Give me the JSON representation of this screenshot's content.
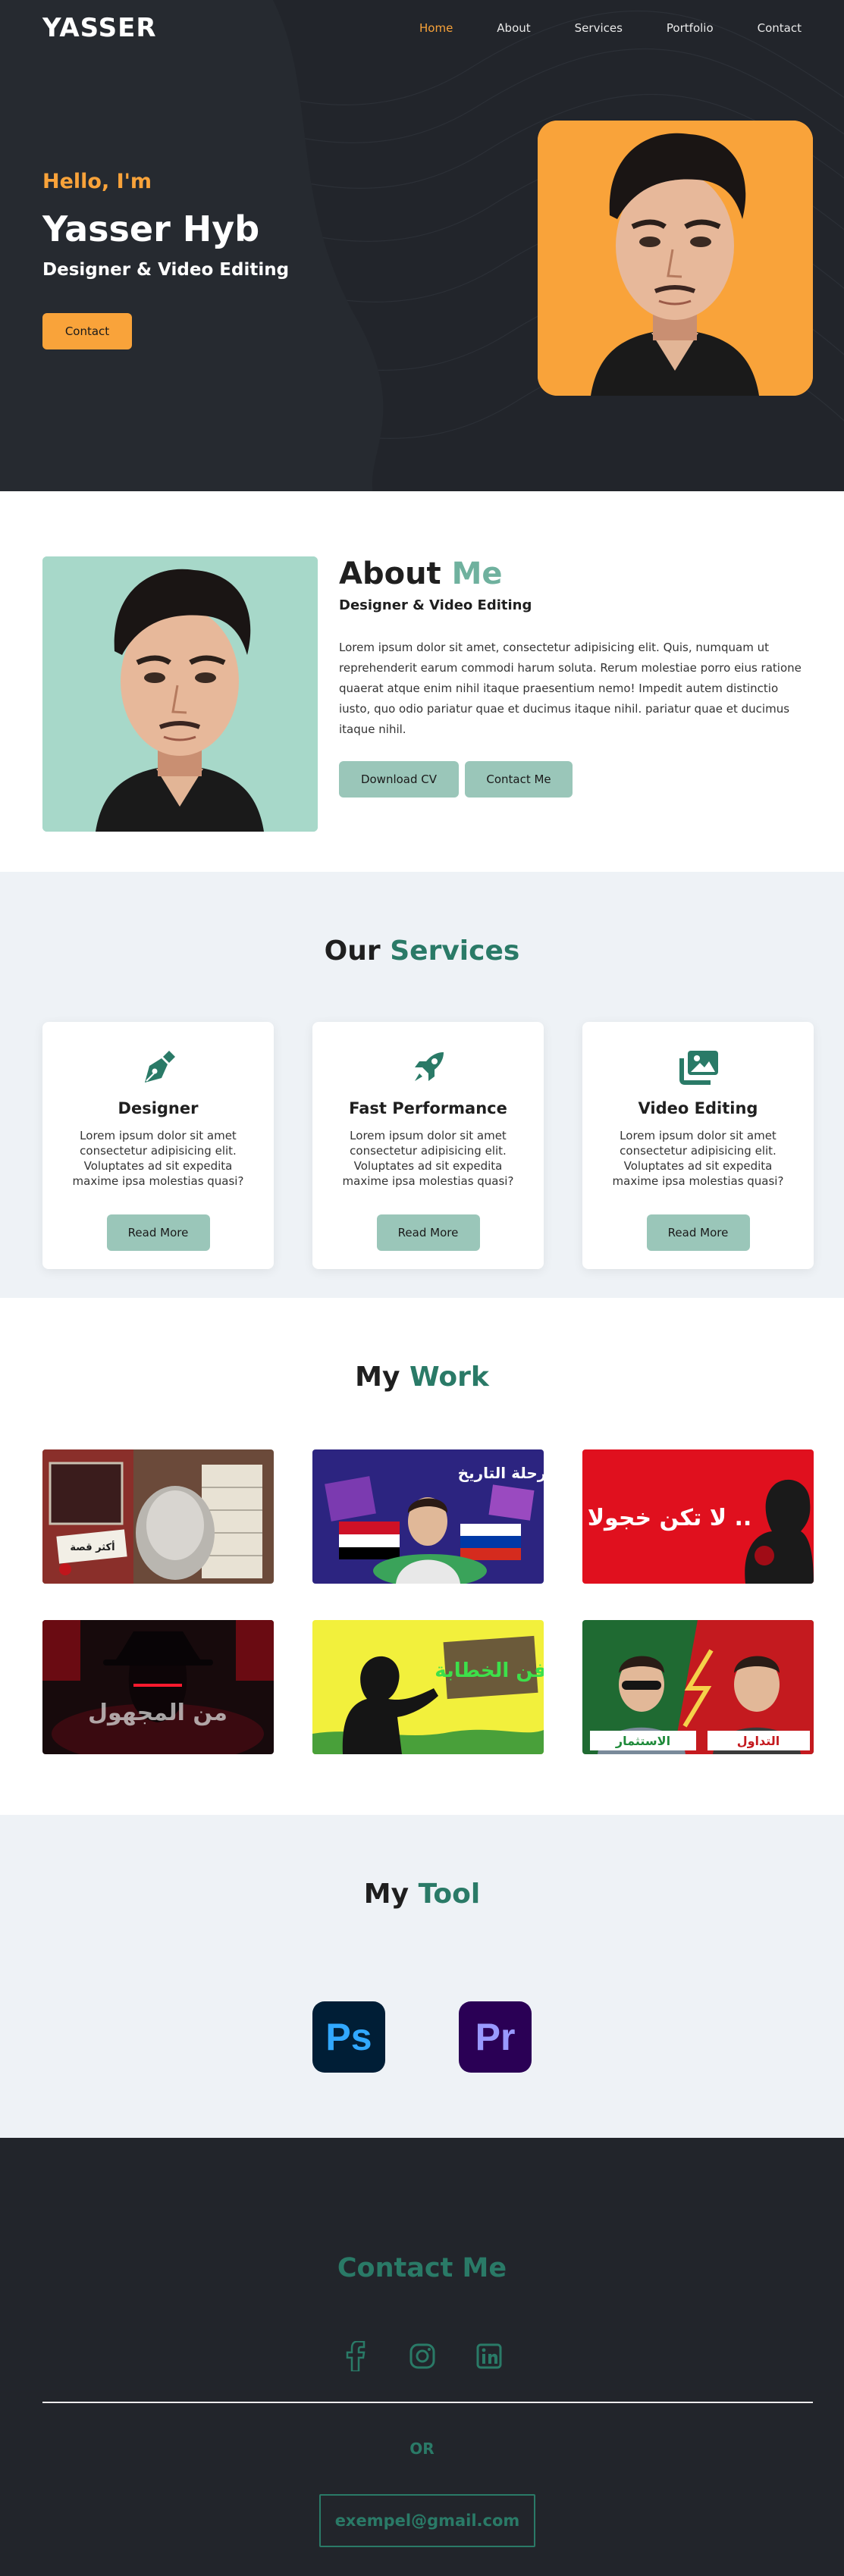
{
  "header": {
    "logo": "YASSER",
    "nav": [
      "Home",
      "About",
      "Services",
      "Portfolio",
      "Contact"
    ],
    "active": "Home"
  },
  "hero": {
    "greeting": "Hello, I'm",
    "name": "Yasser Hyb",
    "role": "Designer & Video Editing",
    "button": "Contact"
  },
  "about": {
    "title_a": "About",
    "title_b": "Me",
    "subtitle": "Designer & Video Editing",
    "paragraph": "Lorem ipsum dolor sit amet, consectetur adipisicing elit. Quis, numquam ut reprehenderit earum commodi harum soluta. Rerum molestiae porro eius ratione quaerat atque enim nihil itaque praesentium nemo! Impedit autem distinctio iusto, quo odio pariatur quae et ducimus itaque nihil. pariatur quae et ducimus itaque nihil.",
    "download_button": "Download CV",
    "contact_button": "Contact Me"
  },
  "services": {
    "title_a": "Our",
    "title_b": "Services",
    "cards": [
      {
        "icon": "pen-icon",
        "title": "Designer",
        "text": "Lorem ipsum dolor sit amet consectetur adipisicing elit. Voluptates ad sit expedita maxime ipsa molestias quasi?",
        "button": "Read More"
      },
      {
        "icon": "rocket-icon",
        "title": "Fast Performance",
        "text": "Lorem ipsum dolor sit amet consectetur adipisicing elit. Voluptates ad sit expedita maxime ipsa molestias quasi?",
        "button": "Read More"
      },
      {
        "icon": "images-icon",
        "title": "Video Editing",
        "text": "Lorem ipsum dolor sit amet consectetur adipisicing elit. Voluptates ad sit expedita maxime ipsa molestias quasi?",
        "button": "Read More"
      }
    ]
  },
  "work": {
    "title_a": "My",
    "title_b": "Work",
    "items": [
      {
        "caption": "أكثر قصة"
      },
      {
        "caption": "رحلة التاريخ"
      },
      {
        "caption": "لا تكن خجولا .."
      },
      {
        "caption": "من المجهول"
      },
      {
        "caption": "فن الخطابة"
      },
      {
        "caption_a": "الاستثمار",
        "caption_b": "التداول"
      }
    ]
  },
  "tools": {
    "title_a": "My",
    "title_b": "Tool",
    "items": [
      {
        "label": "Ps",
        "name": "photoshop-icon"
      },
      {
        "label": "Pr",
        "name": "premiere-icon"
      }
    ]
  },
  "contact": {
    "title": "Contact Me",
    "socials": [
      "facebook-icon",
      "instagram-icon",
      "linkedin-icon"
    ],
    "or": "OR",
    "email": "exempel@gmail.com"
  },
  "colors": {
    "dark": "#22252b",
    "orange": "#f9a33a",
    "green": "#2a7a67",
    "green_light": "#9ac6b9",
    "light_bg": "#eef2f6"
  }
}
